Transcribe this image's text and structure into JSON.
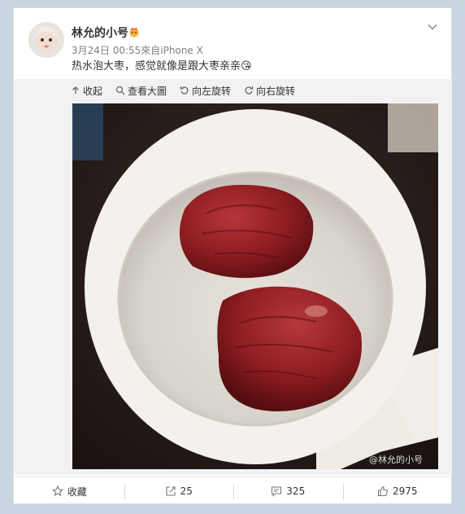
{
  "post": {
    "username": "林允的小号",
    "meta": "3月24日 00:55來自iPhone X",
    "text": "热水泡大枣，感觉就像是跟大枣亲亲😘"
  },
  "toolbar": {
    "collapse": "收起",
    "view_large": "查看大圖",
    "rotate_left": "向左旋转",
    "rotate_right": "向右旋转"
  },
  "image": {
    "watermark": "@林允的小号",
    "colors": {
      "cup": "#f4f1ec",
      "date": "#8e1a1c",
      "background": "#2a1f1b"
    }
  },
  "actions": {
    "favorite": "收藏",
    "repost_count": "25",
    "comment_count": "325",
    "like_count": "2975"
  }
}
